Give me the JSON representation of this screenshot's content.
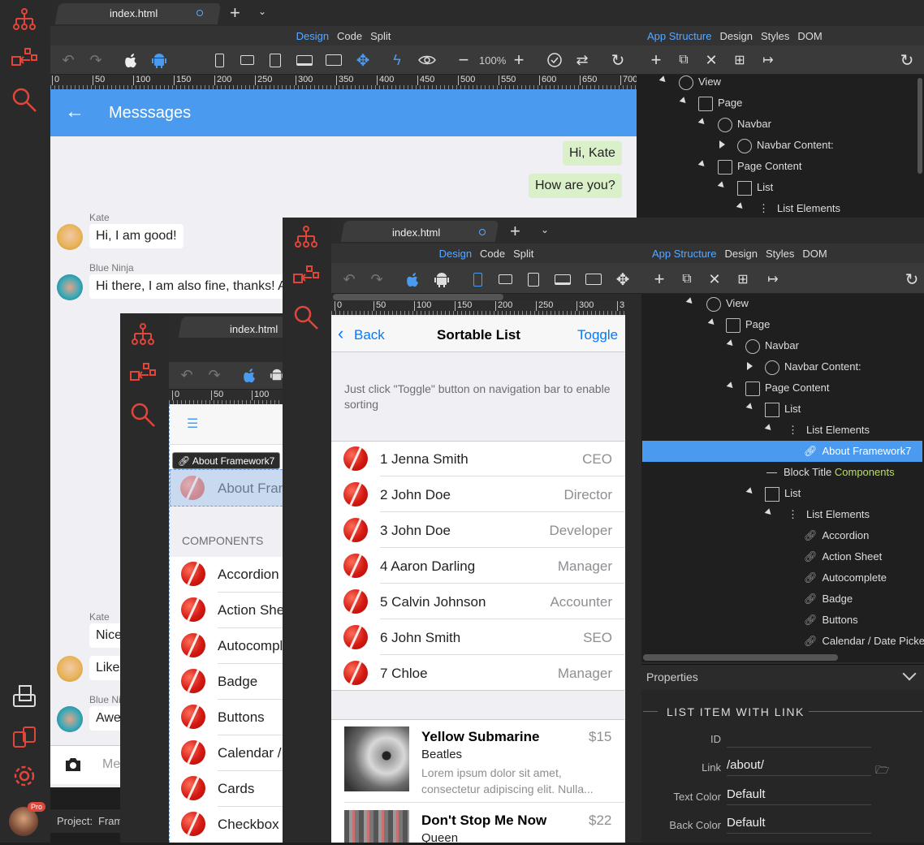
{
  "back_window": {
    "tab_title": "index.html",
    "modes": [
      "Design",
      "Code",
      "Split"
    ],
    "zoom": "100%",
    "ruler": [
      "0",
      "50",
      "100",
      "150",
      "200",
      "250",
      "300",
      "350",
      "400",
      "450",
      "500",
      "550",
      "600",
      "650",
      "700"
    ],
    "navbar_title": "Messsages",
    "messages": [
      {
        "side": "right",
        "text": "Hi, Kate"
      },
      {
        "side": "right",
        "text": "How are you?"
      },
      {
        "side": "left",
        "name": "Kate",
        "text": "Hi, I am good!"
      },
      {
        "side": "left",
        "name": "Blue Ninja",
        "text": "Hi there, I am also fine, thanks! A"
      },
      {
        "side": "left",
        "name": "Kate",
        "text": "Nice"
      },
      {
        "side": "left",
        "name": "",
        "text": "Like"
      },
      {
        "side": "left",
        "name": "Blue Ni",
        "text": "Awe"
      }
    ],
    "message_placeholder": "Me",
    "project_label": "Project:",
    "project_name": "Fram",
    "panel_tabs": [
      "App Structure",
      "Design",
      "Styles",
      "DOM"
    ],
    "tree": [
      "View",
      "Page",
      "Navbar",
      "Navbar Content:",
      "Page Content",
      "List",
      "List Elements"
    ],
    "pro_badge": "Pro"
  },
  "middle_window": {
    "tab_title": "index.html",
    "ruler": [
      "0",
      "50",
      "100"
    ],
    "chip_label": "About Framework7",
    "selected_item": "About Fran",
    "section_title": "COMPONENTS",
    "items": [
      "Accordion",
      "Action She",
      "Autocompl",
      "Badge",
      "Buttons",
      "Calendar /",
      "Cards",
      "Checkbox"
    ]
  },
  "front_window": {
    "tab_title": "index.html",
    "modes": [
      "Design",
      "Code",
      "Split"
    ],
    "ruler": [
      "0",
      "50",
      "100",
      "150",
      "200",
      "250",
      "300",
      "3"
    ],
    "nav_back": "Back",
    "nav_title": "Sortable List",
    "nav_right": "Toggle",
    "description": "Just click \"Toggle\" button on navigation bar to enable sorting",
    "list": [
      {
        "title": "1 Jenna Smith",
        "after": "CEO"
      },
      {
        "title": "2 John Doe",
        "after": "Director"
      },
      {
        "title": "3 John Doe",
        "after": "Developer"
      },
      {
        "title": "4 Aaron Darling",
        "after": "Manager"
      },
      {
        "title": "5 Calvin Johnson",
        "after": "Accounter"
      },
      {
        "title": "6 John Smith",
        "after": "SEO"
      },
      {
        "title": "7 Chloe",
        "after": "Manager"
      }
    ],
    "media": [
      {
        "title": "Yellow Submarine",
        "price": "$15",
        "subtitle": "Beatles",
        "text": "Lorem ipsum dolor sit amet, consectetur adipiscing elit. Nulla..."
      },
      {
        "title": "Don't Stop Me Now",
        "price": "$22",
        "subtitle": "Queen",
        "text": ""
      }
    ],
    "panel_tabs": [
      "App Structure",
      "Design",
      "Styles",
      "DOM"
    ],
    "tree": [
      {
        "label": "View"
      },
      {
        "label": "Page"
      },
      {
        "label": "Navbar"
      },
      {
        "label": "Navbar Content:"
      },
      {
        "label": "Page Content"
      },
      {
        "label": "List"
      },
      {
        "label": "List Elements"
      },
      {
        "label": "About Framework7"
      },
      {
        "label": "Block Title",
        "extra": "Components"
      },
      {
        "label": "List"
      },
      {
        "label": "List Elements"
      },
      {
        "label": "Accordion"
      },
      {
        "label": "Action Sheet"
      },
      {
        "label": "Autocomplete"
      },
      {
        "label": "Badge"
      },
      {
        "label": "Buttons"
      },
      {
        "label": "Calendar / Date Picke"
      }
    ],
    "properties": {
      "header": "Properties",
      "section": "LIST ITEM WITH LINK",
      "fields": [
        {
          "label": "ID",
          "value": ""
        },
        {
          "label": "Link",
          "value": "/about/"
        },
        {
          "label": "Text Color",
          "value": "Default"
        },
        {
          "label": "Back Color",
          "value": "Default"
        }
      ]
    }
  },
  "colors": {
    "accent": "#4a9bf0",
    "ios_blue": "#007aff",
    "selected": "#4a9bf0",
    "components_green": "#b6e05c"
  }
}
